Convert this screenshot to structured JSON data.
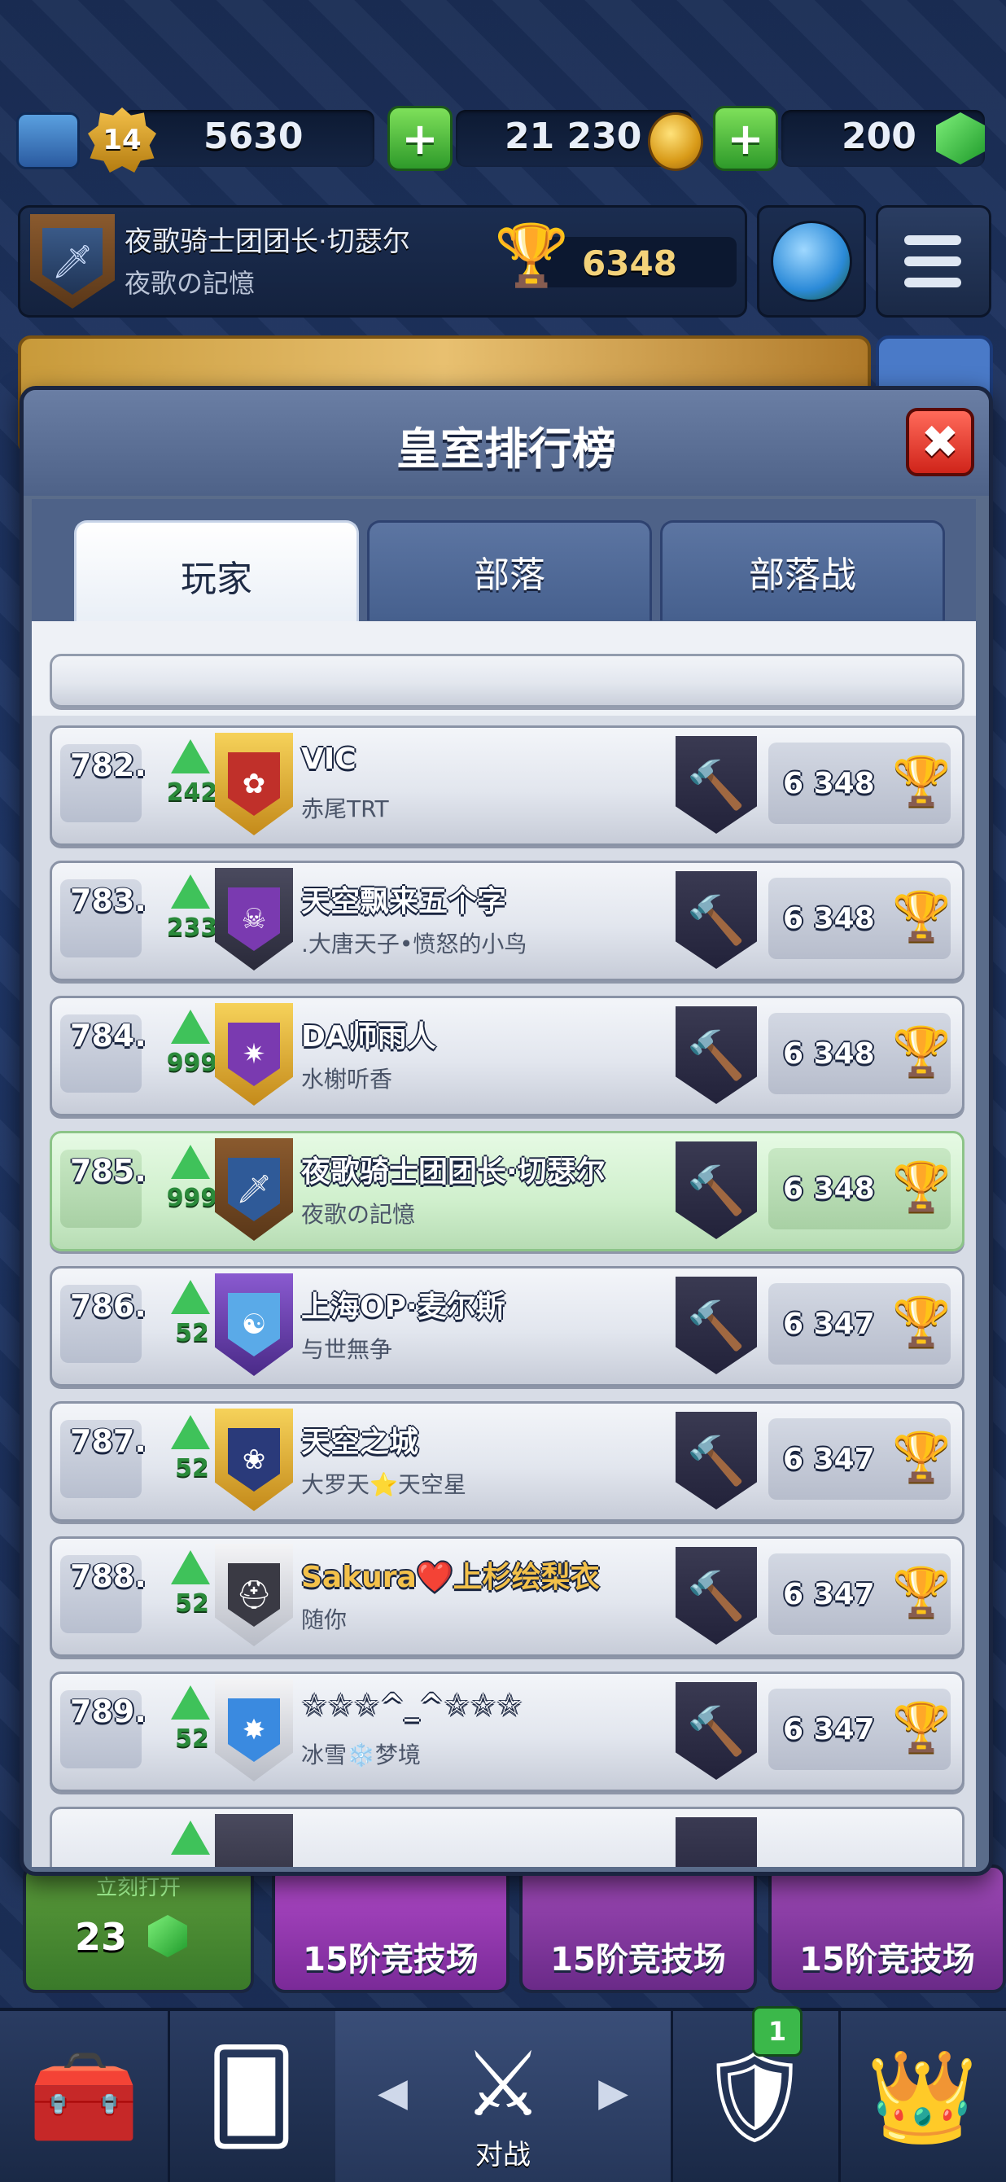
{
  "topbar": {
    "level": "14",
    "experience": "5630",
    "gold": "21 230",
    "gems": "200"
  },
  "player": {
    "name": "夜歌骑士团团长·切瑟尔",
    "clan": "夜歌の記憶",
    "trophies": "6348"
  },
  "modal": {
    "title": "皇室排行榜",
    "close_label": "✖",
    "tabs": [
      "玩家",
      "部落",
      "部落战"
    ]
  },
  "rows": [
    {
      "rank": "782.",
      "level": "242",
      "name": "VIC",
      "clan": "赤尾TRT",
      "trophies": "6 348"
    },
    {
      "rank": "783.",
      "level": "233",
      "name": "天空飘来五个字",
      "clan": ".大唐天子•愤怒的小鸟",
      "trophies": "6 348"
    },
    {
      "rank": "784.",
      "level": "999",
      "name": "DA师雨人",
      "clan": "水榭听香",
      "trophies": "6 348"
    },
    {
      "rank": "785.",
      "level": "999",
      "name": "夜歌骑士团团长·切瑟尔",
      "clan": "夜歌の記憶",
      "trophies": "6 348"
    },
    {
      "rank": "786.",
      "level": "52",
      "name": "上海OP·麦尔斯",
      "clan": "与世無争",
      "trophies": "6 347"
    },
    {
      "rank": "787.",
      "level": "52",
      "name": "天空之城",
      "clan": "大罗天⭐天空星",
      "trophies": "6 347"
    },
    {
      "rank": "788.",
      "level": "52",
      "name_part1": "Sakura",
      "name_heart": "❤️",
      "name_part2": "上杉绘梨衣",
      "clan": "随你",
      "trophies": "6 347"
    },
    {
      "rank": "789.",
      "level": "52",
      "name": "☆☆☆^_^☆☆☆",
      "clan": "冰雪❄️梦境",
      "trophies": "6 347"
    }
  ],
  "chests": {
    "unlock_label": "立刻打开",
    "unlock_cost": "23",
    "arena_label": "15阶竞技场"
  },
  "nav": {
    "battle_label": "对战",
    "clan_badge": "1"
  }
}
